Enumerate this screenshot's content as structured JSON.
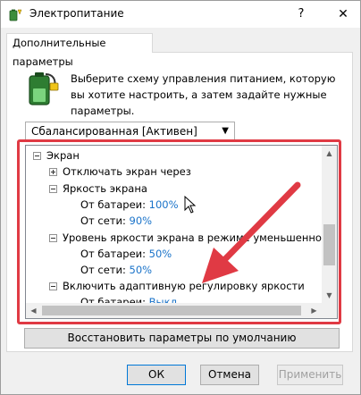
{
  "window": {
    "title": "Электропитание"
  },
  "titlebar": {
    "help": "?",
    "close": "✕"
  },
  "tab": {
    "label": "Дополнительные параметры"
  },
  "description": "Выберите схему управления питанием, которую вы хотите настроить, а затем задайте нужные параметры.",
  "scheme": {
    "selected": "Сбалансированная [Активен]"
  },
  "tree": {
    "root": "Экран",
    "turn_off": "Отключать экран через",
    "brightness": {
      "label": "Яркость экрана",
      "battery_label": "От батареи:",
      "battery_value": "100%",
      "ac_label": "От сети:",
      "ac_value": "90%"
    },
    "dimmed": {
      "label": "Уровень яркости экрана в режиме уменьшенной ярк",
      "battery_label": "От батареи:",
      "battery_value": "50%",
      "ac_label": "От сети:",
      "ac_value": "50%"
    },
    "adaptive": {
      "label": "Включить адаптивную регулировку яркости",
      "battery_label": "От батареи:",
      "battery_value": "Выкл"
    }
  },
  "restore_defaults": "Восстановить параметры по умолчанию",
  "buttons": {
    "ok": "ОК",
    "cancel": "Отмена",
    "apply": "Применить"
  },
  "colors": {
    "highlight": "#e03a44",
    "link_value": "#1a73c9",
    "accent": "#0078d7"
  }
}
